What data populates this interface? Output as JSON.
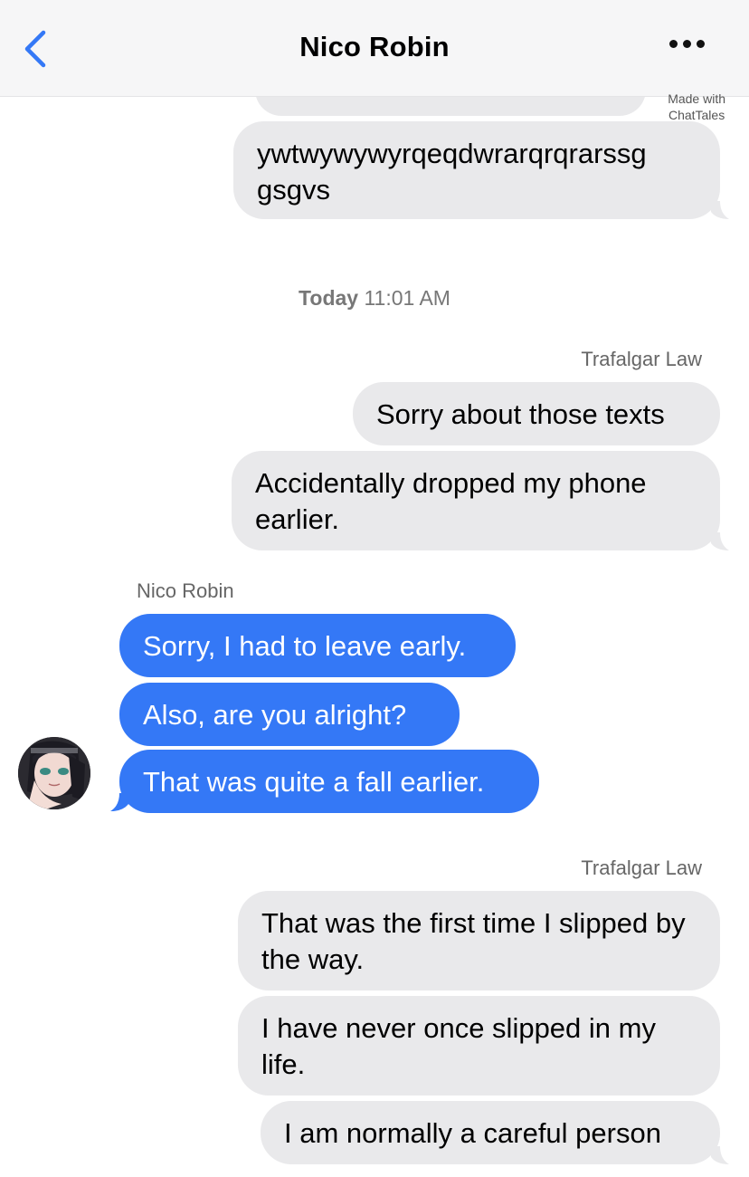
{
  "header": {
    "title": "Nico Robin",
    "back_icon": "chevron-left-icon",
    "more_icon": "ellipsis-icon",
    "accent": "#3478f6"
  },
  "watermark": {
    "line1": "Made with",
    "line2": "ChatTales"
  },
  "timestamp": {
    "day": "Today",
    "time": "11:01 AM"
  },
  "messages": [
    {
      "text": "ywtwywywyrqeqdwrarqrqrarssg gsgvs"
    },
    {
      "sender": "Trafalgar Law"
    },
    {
      "text": "Sorry about those texts"
    },
    {
      "text": "Accidentally dropped my phone earlier."
    },
    {
      "sender": "Nico Robin"
    },
    {
      "text": "Sorry, I had to leave early."
    },
    {
      "text": "Also, are you alright?"
    },
    {
      "text": "That was quite a fall earlier."
    },
    {
      "sender": "Trafalgar Law"
    },
    {
      "text": "That was the first time I slipped by the way."
    },
    {
      "text": "I have never once slipped in my life."
    },
    {
      "text": "I am normally a careful person"
    }
  ],
  "colors": {
    "incoming_bubble": "#3478f6",
    "outgoing_bubble": "#e9e9eb"
  }
}
